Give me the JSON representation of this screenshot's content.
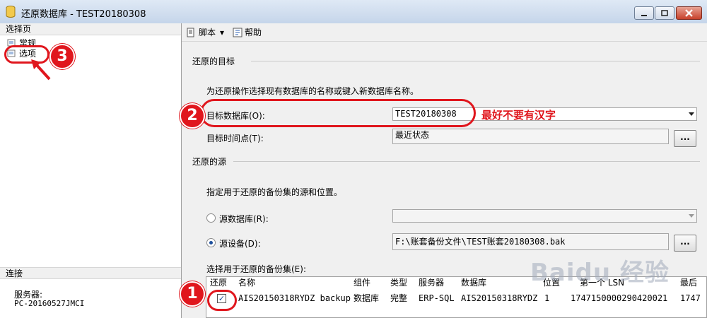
{
  "window": {
    "title": "还原数据库 - TEST20180308"
  },
  "left": {
    "select_page_header": "选择页",
    "nav": [
      {
        "label": "常规"
      },
      {
        "label": "选项"
      }
    ],
    "connect_header": "连接",
    "server_label": "服务器:",
    "server_value": "PC-20160527JMCI"
  },
  "toolbar": {
    "script": "脚本",
    "help": "帮助"
  },
  "dest": {
    "section_title": "还原的目标",
    "instruction": "为还原操作选择现有数据库的名称或键入新数据库名称。",
    "db_label": "目标数据库(O):",
    "db_value": "TEST20180308",
    "time_label": "目标时间点(T):",
    "time_value": "最近状态",
    "browse": "..."
  },
  "source": {
    "section_title": "还原的源",
    "instruction": "指定用于还原的备份集的源和位置。",
    "from_db_label": "源数据库(R):",
    "from_device_label": "源设备(D):",
    "device_value": "F:\\账套备份文件\\TEST账套20180308.bak",
    "browse": "...",
    "backup_sets_label": "选择用于还原的备份集(E):"
  },
  "grid": {
    "headers": [
      "还原",
      "名称",
      "组件",
      "类型",
      "服务器",
      "数据库",
      "位置",
      "第一个 LSN",
      "最后"
    ],
    "row": {
      "restore": true,
      "name": "AIS20150318RYDZ backup",
      "component": "数据库",
      "type": "完整",
      "server": "ERP-SQL",
      "database": "AIS20150318RYDZ",
      "position": "1",
      "first_lsn": "1747150000290420021",
      "last_lsn": "1747"
    }
  },
  "annotations": {
    "n1": "1",
    "n2": "2",
    "n3": "3",
    "note": "最好不要有汉字"
  },
  "watermark": "Baidu 经验",
  "colors": {
    "accent_red": "#e0161d",
    "titlebar": "#c5d5ea"
  }
}
